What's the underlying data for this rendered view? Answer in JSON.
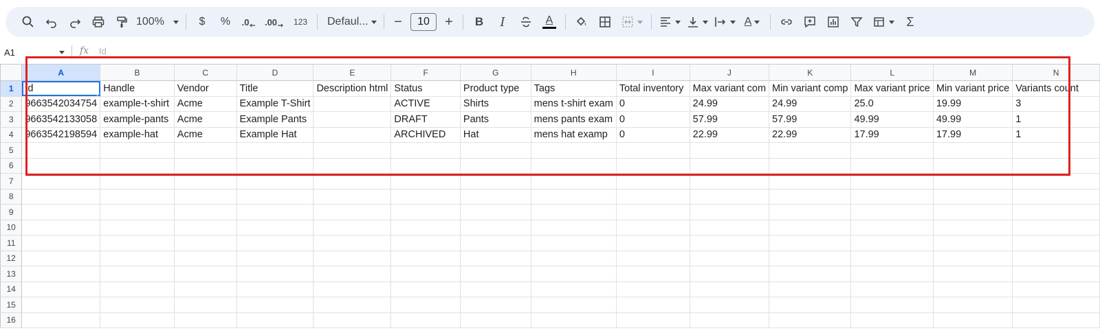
{
  "toolbar": {
    "zoom": "100%",
    "currency": "$",
    "percent": "%",
    "decrease_decimal": ".0",
    "increase_decimal": ".00",
    "number_format": "123",
    "font": "Defaul...",
    "font_size": "10",
    "decrease_size": "−",
    "increase_size": "+",
    "bold": "B",
    "italic": "I",
    "text_color_glyph": "A",
    "rotate_glyph": "A",
    "sum": "Σ",
    "text_color_swatch": "#000000"
  },
  "formula_bar": {
    "cell_ref": "A1",
    "fx": "fx",
    "value": "Id"
  },
  "grid": {
    "columns": [
      "A",
      "B",
      "C",
      "D",
      "E",
      "F",
      "G",
      "H",
      "I",
      "J",
      "K",
      "L",
      "M",
      "N"
    ],
    "row_numbers": [
      "1",
      "2",
      "3",
      "4",
      "5",
      "6",
      "7",
      "8",
      "9",
      "10",
      "11",
      "12",
      "13",
      "14",
      "15",
      "16"
    ],
    "active_column": "A",
    "active_row": "1",
    "rows": [
      [
        "Id",
        "Handle",
        "Vendor",
        "Title",
        "Description html",
        "Status",
        "Product type",
        "Tags",
        "Total inventory",
        "Max variant com",
        "Min variant comp",
        "Max variant price",
        "Min variant price",
        "Variants count"
      ],
      [
        "9663542034754",
        "example-t-shirt",
        "Acme",
        "Example T-Shirt",
        "",
        "ACTIVE",
        "Shirts",
        "mens t-shirt exam",
        "0",
        "24.99",
        "24.99",
        "25.0",
        "19.99",
        "3"
      ],
      [
        "9663542133058",
        "example-pants",
        "Acme",
        "Example Pants",
        "",
        "DRAFT",
        "Pants",
        "mens pants exam",
        "0",
        "57.99",
        "57.99",
        "49.99",
        "49.99",
        "1"
      ],
      [
        "9663542198594",
        "example-hat",
        "Acme",
        "Example Hat",
        "",
        "ARCHIVED",
        "Hat",
        "mens hat examp",
        "0",
        "22.99",
        "22.99",
        "17.99",
        "17.99",
        "1"
      ],
      [
        "",
        "",
        "",
        "",
        "",
        "",
        "",
        "",
        "",
        "",
        "",
        "",
        "",
        ""
      ],
      [
        "",
        "",
        "",
        "",
        "",
        "",
        "",
        "",
        "",
        "",
        "",
        "",
        "",
        ""
      ],
      [
        "",
        "",
        "",
        "",
        "",
        "",
        "",
        "",
        "",
        "",
        "",
        "",
        "",
        ""
      ],
      [
        "",
        "",
        "",
        "",
        "",
        "",
        "",
        "",
        "",
        "",
        "",
        "",
        "",
        ""
      ],
      [
        "",
        "",
        "",
        "",
        "",
        "",
        "",
        "",
        "",
        "",
        "",
        "",
        "",
        ""
      ],
      [
        "",
        "",
        "",
        "",
        "",
        "",
        "",
        "",
        "",
        "",
        "",
        "",
        "",
        ""
      ],
      [
        "",
        "",
        "",
        "",
        "",
        "",
        "",
        "",
        "",
        "",
        "",
        "",
        "",
        ""
      ],
      [
        "",
        "",
        "",
        "",
        "",
        "",
        "",
        "",
        "",
        "",
        "",
        "",
        "",
        ""
      ],
      [
        "",
        "",
        "",
        "",
        "",
        "",
        "",
        "",
        "",
        "",
        "",
        "",
        "",
        ""
      ],
      [
        "",
        "",
        "",
        "",
        "",
        "",
        "",
        "",
        "",
        "",
        "",
        "",
        "",
        ""
      ],
      [
        "",
        "",
        "",
        "",
        "",
        "",
        "",
        "",
        "",
        "",
        "",
        "",
        "",
        ""
      ],
      [
        "",
        "",
        "",
        "",
        "",
        "",
        "",
        "",
        "",
        "",
        "",
        "",
        "",
        ""
      ]
    ]
  }
}
